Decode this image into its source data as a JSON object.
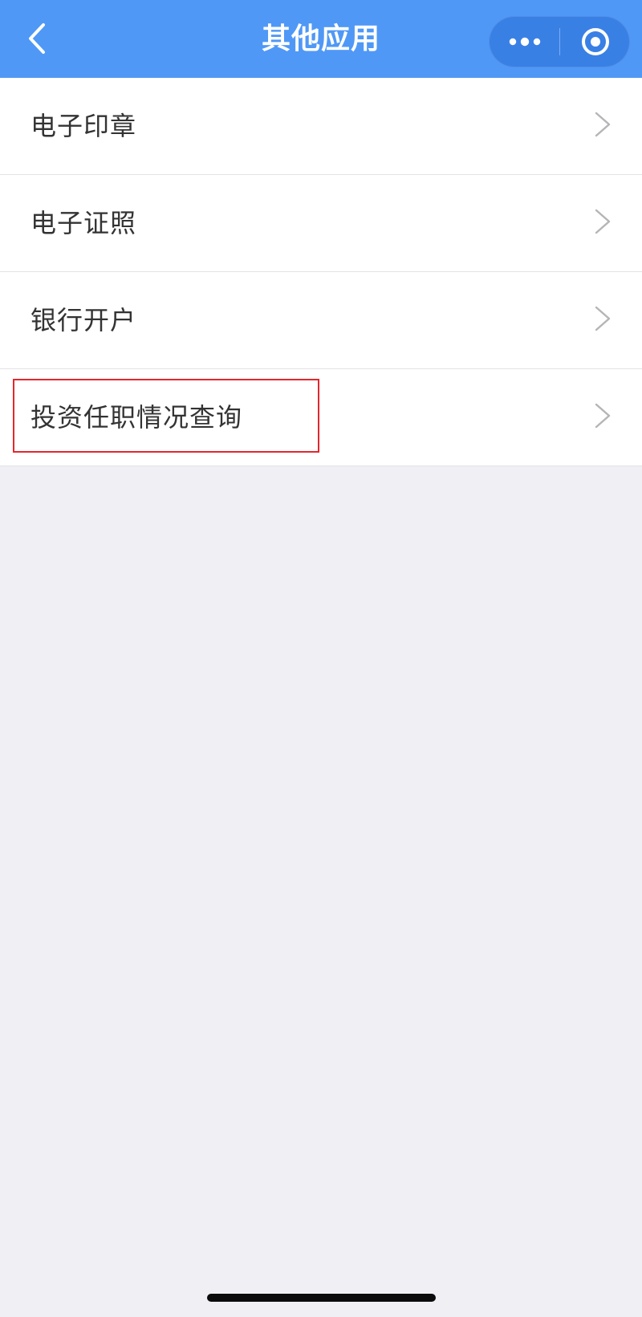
{
  "header": {
    "title": "其他应用",
    "back_icon": "chevron-left-icon",
    "more_icon": "more-dots-icon",
    "close_icon": "target-circle-icon",
    "background_color": "#4f98f6"
  },
  "list": {
    "items": [
      {
        "label": "电子印章"
      },
      {
        "label": "电子证照"
      },
      {
        "label": "银行开户"
      },
      {
        "label": "投资任职情况查询"
      }
    ],
    "chevron_icon": "chevron-right-icon"
  },
  "highlight": {
    "color": "#e4262c",
    "target": "投资任职情况查询"
  }
}
